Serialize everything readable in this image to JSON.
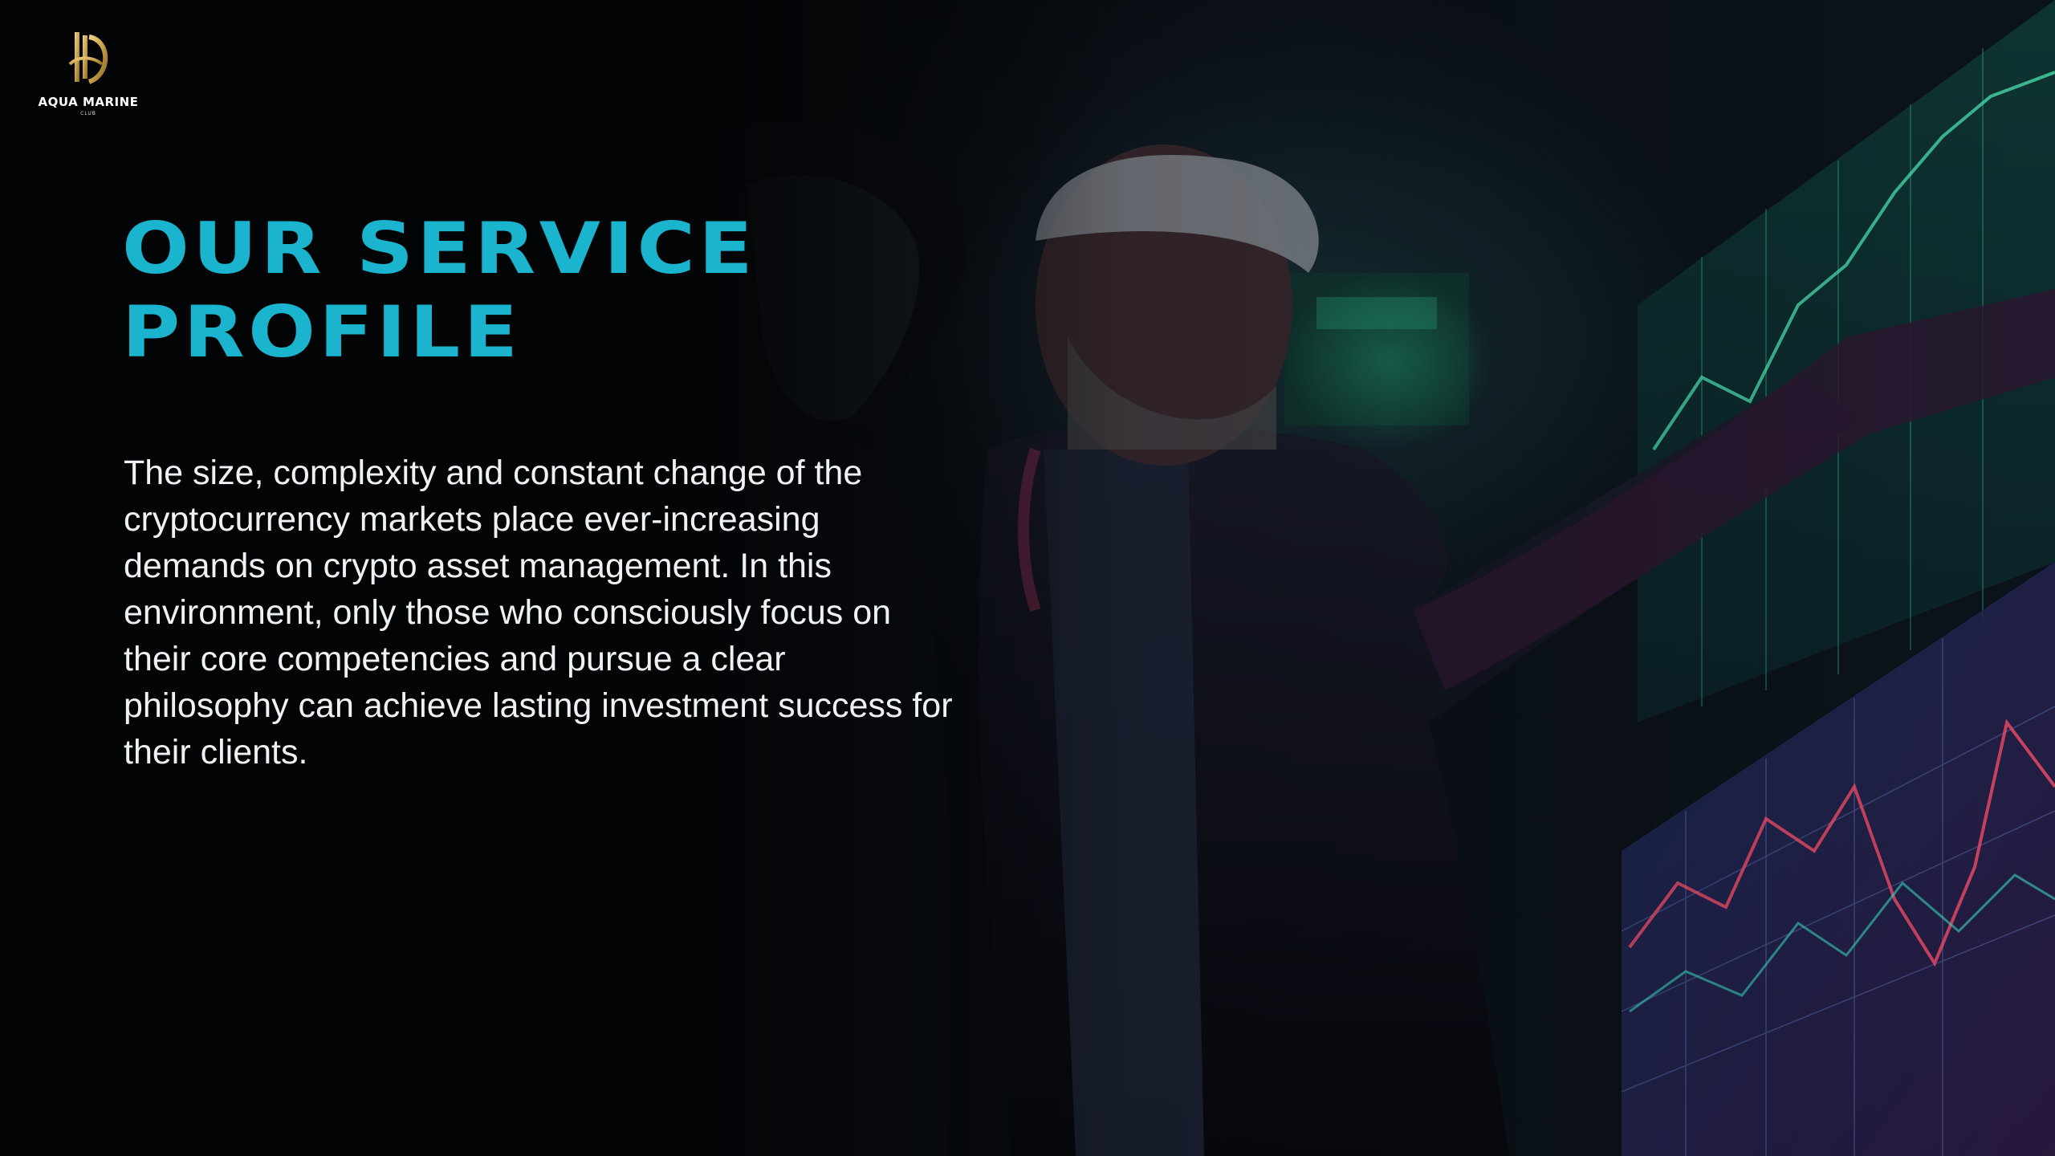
{
  "brand": {
    "name": "AQUA MARINE",
    "sub": "CLUB"
  },
  "headline": {
    "line1": "OUR SERVICE",
    "line2": "PROFILE"
  },
  "body": {
    "paragraph": "The size, complexity and constant change of the cryptocurrency markets place ever-increasing demands on crypto asset management. In this environment, only those who consciously focus on their core competencies and pursue a clear philosophy can achieve lasting investment success for their clients."
  },
  "colors": {
    "accent": "#1ab4cf",
    "background": "#040608",
    "text": "#eef2f4",
    "logo_gold": "#c9a24a"
  }
}
